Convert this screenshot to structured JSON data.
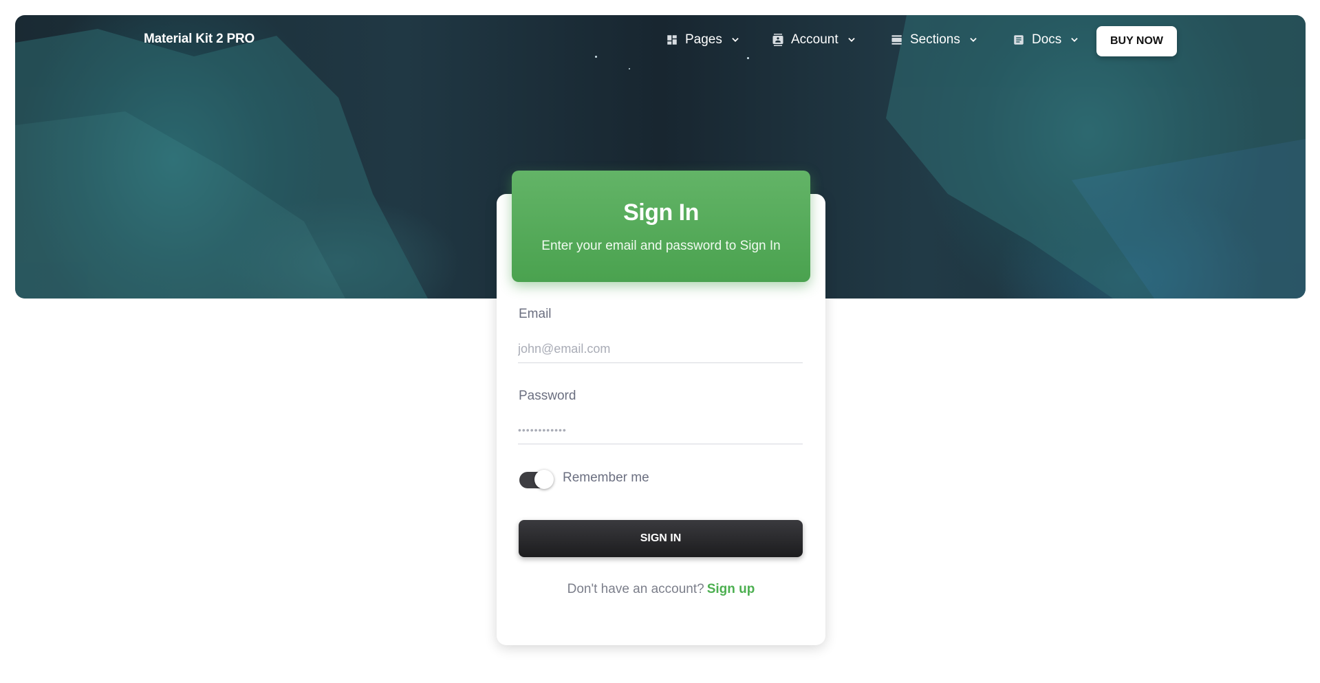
{
  "navbar": {
    "brand": "Material Kit 2 PRO",
    "items": [
      {
        "label": "Pages",
        "icon": "dashboard-icon"
      },
      {
        "label": "Account",
        "icon": "contact-card-icon"
      },
      {
        "label": "Sections",
        "icon": "view-day-icon"
      },
      {
        "label": "Docs",
        "icon": "article-icon"
      }
    ],
    "buy_label": "BUY NOW"
  },
  "signin": {
    "title": "Sign In",
    "subtitle": "Enter your email and password to Sign In",
    "email_label": "Email",
    "email_placeholder": "john@email.com",
    "password_label": "Password",
    "password_placeholder": "••••••••••••",
    "remember_label": "Remember me",
    "remember_checked": true,
    "button_label": "SIGN IN",
    "no_account_text": "Don't have an account?",
    "signup_link": "Sign up"
  },
  "colors": {
    "accent": "#4caf50",
    "button_dark": "#1c1c1e",
    "hero_dark": "#1a2a33"
  }
}
